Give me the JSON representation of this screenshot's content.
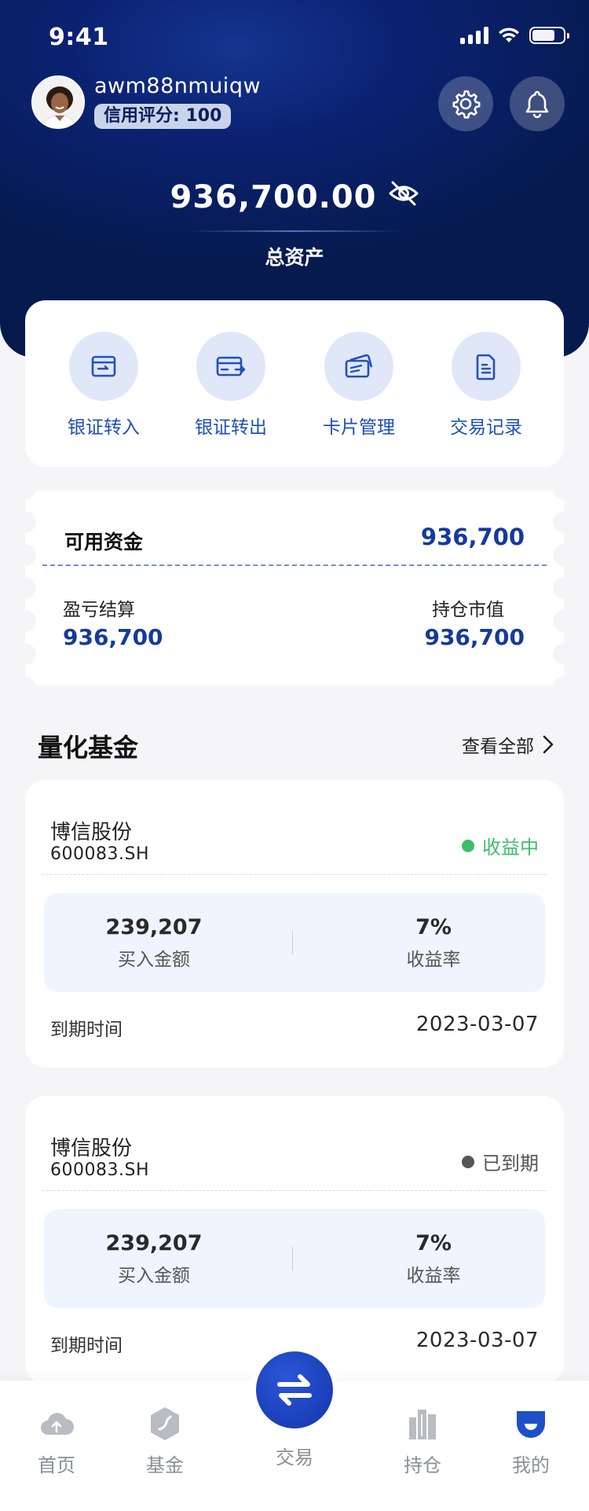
{
  "status_bar": {
    "time": "9:41"
  },
  "user": {
    "name": "awm88nmuiqw",
    "credit_label": "信用评分: 100"
  },
  "assets": {
    "total_value": "936,700.00",
    "total_label": "总资产"
  },
  "quick_actions": [
    {
      "label": "银证转入",
      "icon": "transfer-in-icon"
    },
    {
      "label": "银证转出",
      "icon": "transfer-out-icon"
    },
    {
      "label": "卡片管理",
      "icon": "cards-icon"
    },
    {
      "label": "交易记录",
      "icon": "document-icon"
    }
  ],
  "funds": {
    "available_label": "可用资金",
    "available_value": "936,700",
    "pl_label": "盈亏结算",
    "pl_value": "936,700",
    "market_label": "持仓市值",
    "market_value": "936,700"
  },
  "section": {
    "title": "量化基金",
    "view_all": "查看全部"
  },
  "fund_cards": [
    {
      "name": "博信股份",
      "code": "600083.SH",
      "status": "收益中",
      "status_color": "#3cbf6a",
      "buy_amount": "239,207",
      "buy_label": "买入金额",
      "yield_value": "7%",
      "yield_label": "收益率",
      "expire_label": "到期时间",
      "expire_value": "2023-03-07"
    },
    {
      "name": "博信股份",
      "code": "600083.SH",
      "status": "已到期",
      "status_color": "#555555",
      "buy_amount": "239,207",
      "buy_label": "买入金额",
      "yield_value": "7%",
      "yield_label": "收益率",
      "expire_label": "到期时间",
      "expire_value": "2023-03-07"
    }
  ],
  "tabbar": {
    "home": "首页",
    "fund": "基金",
    "trade": "交易",
    "holdings": "持仓",
    "mine": "我的"
  },
  "colors": {
    "brand_dark": "#061a4e",
    "accent_blue": "#153a9a",
    "fab_blue": "#1a3fb8"
  }
}
